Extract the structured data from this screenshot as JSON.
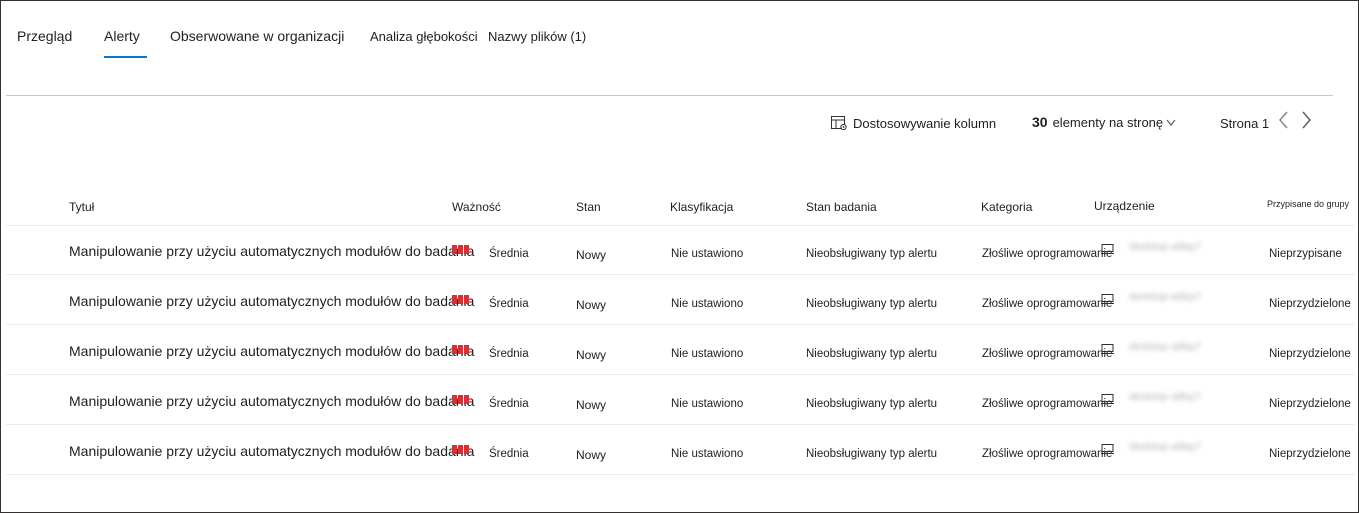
{
  "tabs": [
    {
      "label": "Przegląd"
    },
    {
      "label": "Alerty",
      "active": true
    },
    {
      "label": "Obserwowane w organizacji"
    },
    {
      "label": "Analiza głębokości"
    },
    {
      "label": "Nazwy plików (1)"
    }
  ],
  "toolbar": {
    "customize_label": "Dostosowywanie kolumn",
    "page_size_value": "30",
    "page_size_label": "elementy na stronę",
    "page_label": "Strona 1"
  },
  "table": {
    "headers": {
      "title": "Tytuł",
      "severity": "Ważność",
      "status": "Stan",
      "classification": "Klasyfikacja",
      "investigation": "Stan badania",
      "category": "Kategoria",
      "device": "Urządzenie",
      "assigned": "Przypisane do grupy"
    },
    "rows": [
      {
        "title": "Manipulowanie przy użyciu automatycznych modułów do badania",
        "severity": "Średnia",
        "status": "Nowy",
        "classification": "Nie ustawiono",
        "investigation": "Nieobsługiwany typ alertu",
        "category": "Złośliwe oprogramowanie",
        "device": "desktop-a8kp7",
        "assigned": "Nieprzypisane"
      },
      {
        "title": "Manipulowanie przy użyciu automatycznych modułów do badania",
        "severity": "Średnia",
        "status": "Nowy",
        "classification": "Nie ustawiono",
        "investigation": "Nieobsługiwany typ alertu",
        "category": "Złośliwe oprogramowanie",
        "device": "desktop-a8kp7",
        "assigned": "Nieprzydzielone"
      },
      {
        "title": "Manipulowanie przy użyciu automatycznych modułów do badania",
        "severity": "Średnia",
        "status": "Nowy",
        "classification": "Nie ustawiono",
        "investigation": "Nieobsługiwany typ alertu",
        "category": "Złośliwe oprogramowanie",
        "device": "desktop-a8kp7",
        "assigned": "Nieprzydzielone"
      },
      {
        "title": "Manipulowanie przy użyciu automatycznych modułów do badania",
        "severity": "Średnia",
        "status": "Nowy",
        "classification": "Nie ustawiono",
        "investigation": "Nieobsługiwany typ alertu",
        "category": "Złośliwe oprogramowanie",
        "device": "desktop-a8kp7",
        "assigned": "Nieprzydzielone"
      },
      {
        "title": "Manipulowanie przy użyciu automatycznych modułów do badania",
        "severity": "Średnia",
        "status": "Nowy",
        "classification": "Nie ustawiono",
        "investigation": "Nieobsługiwany typ alertu",
        "category": "Złośliwe oprogramowanie",
        "device": "desktop-a8kp7",
        "assigned": "Nieprzydzielone"
      }
    ]
  },
  "icons": {
    "customize": "table-settings-icon",
    "device": "device-icon",
    "prev": "chevron-left-icon",
    "next": "chevron-right-icon",
    "dropdown": "chevron-down-icon"
  },
  "colors": {
    "accent": "#0078d4",
    "severity_medium": "#d13438"
  }
}
